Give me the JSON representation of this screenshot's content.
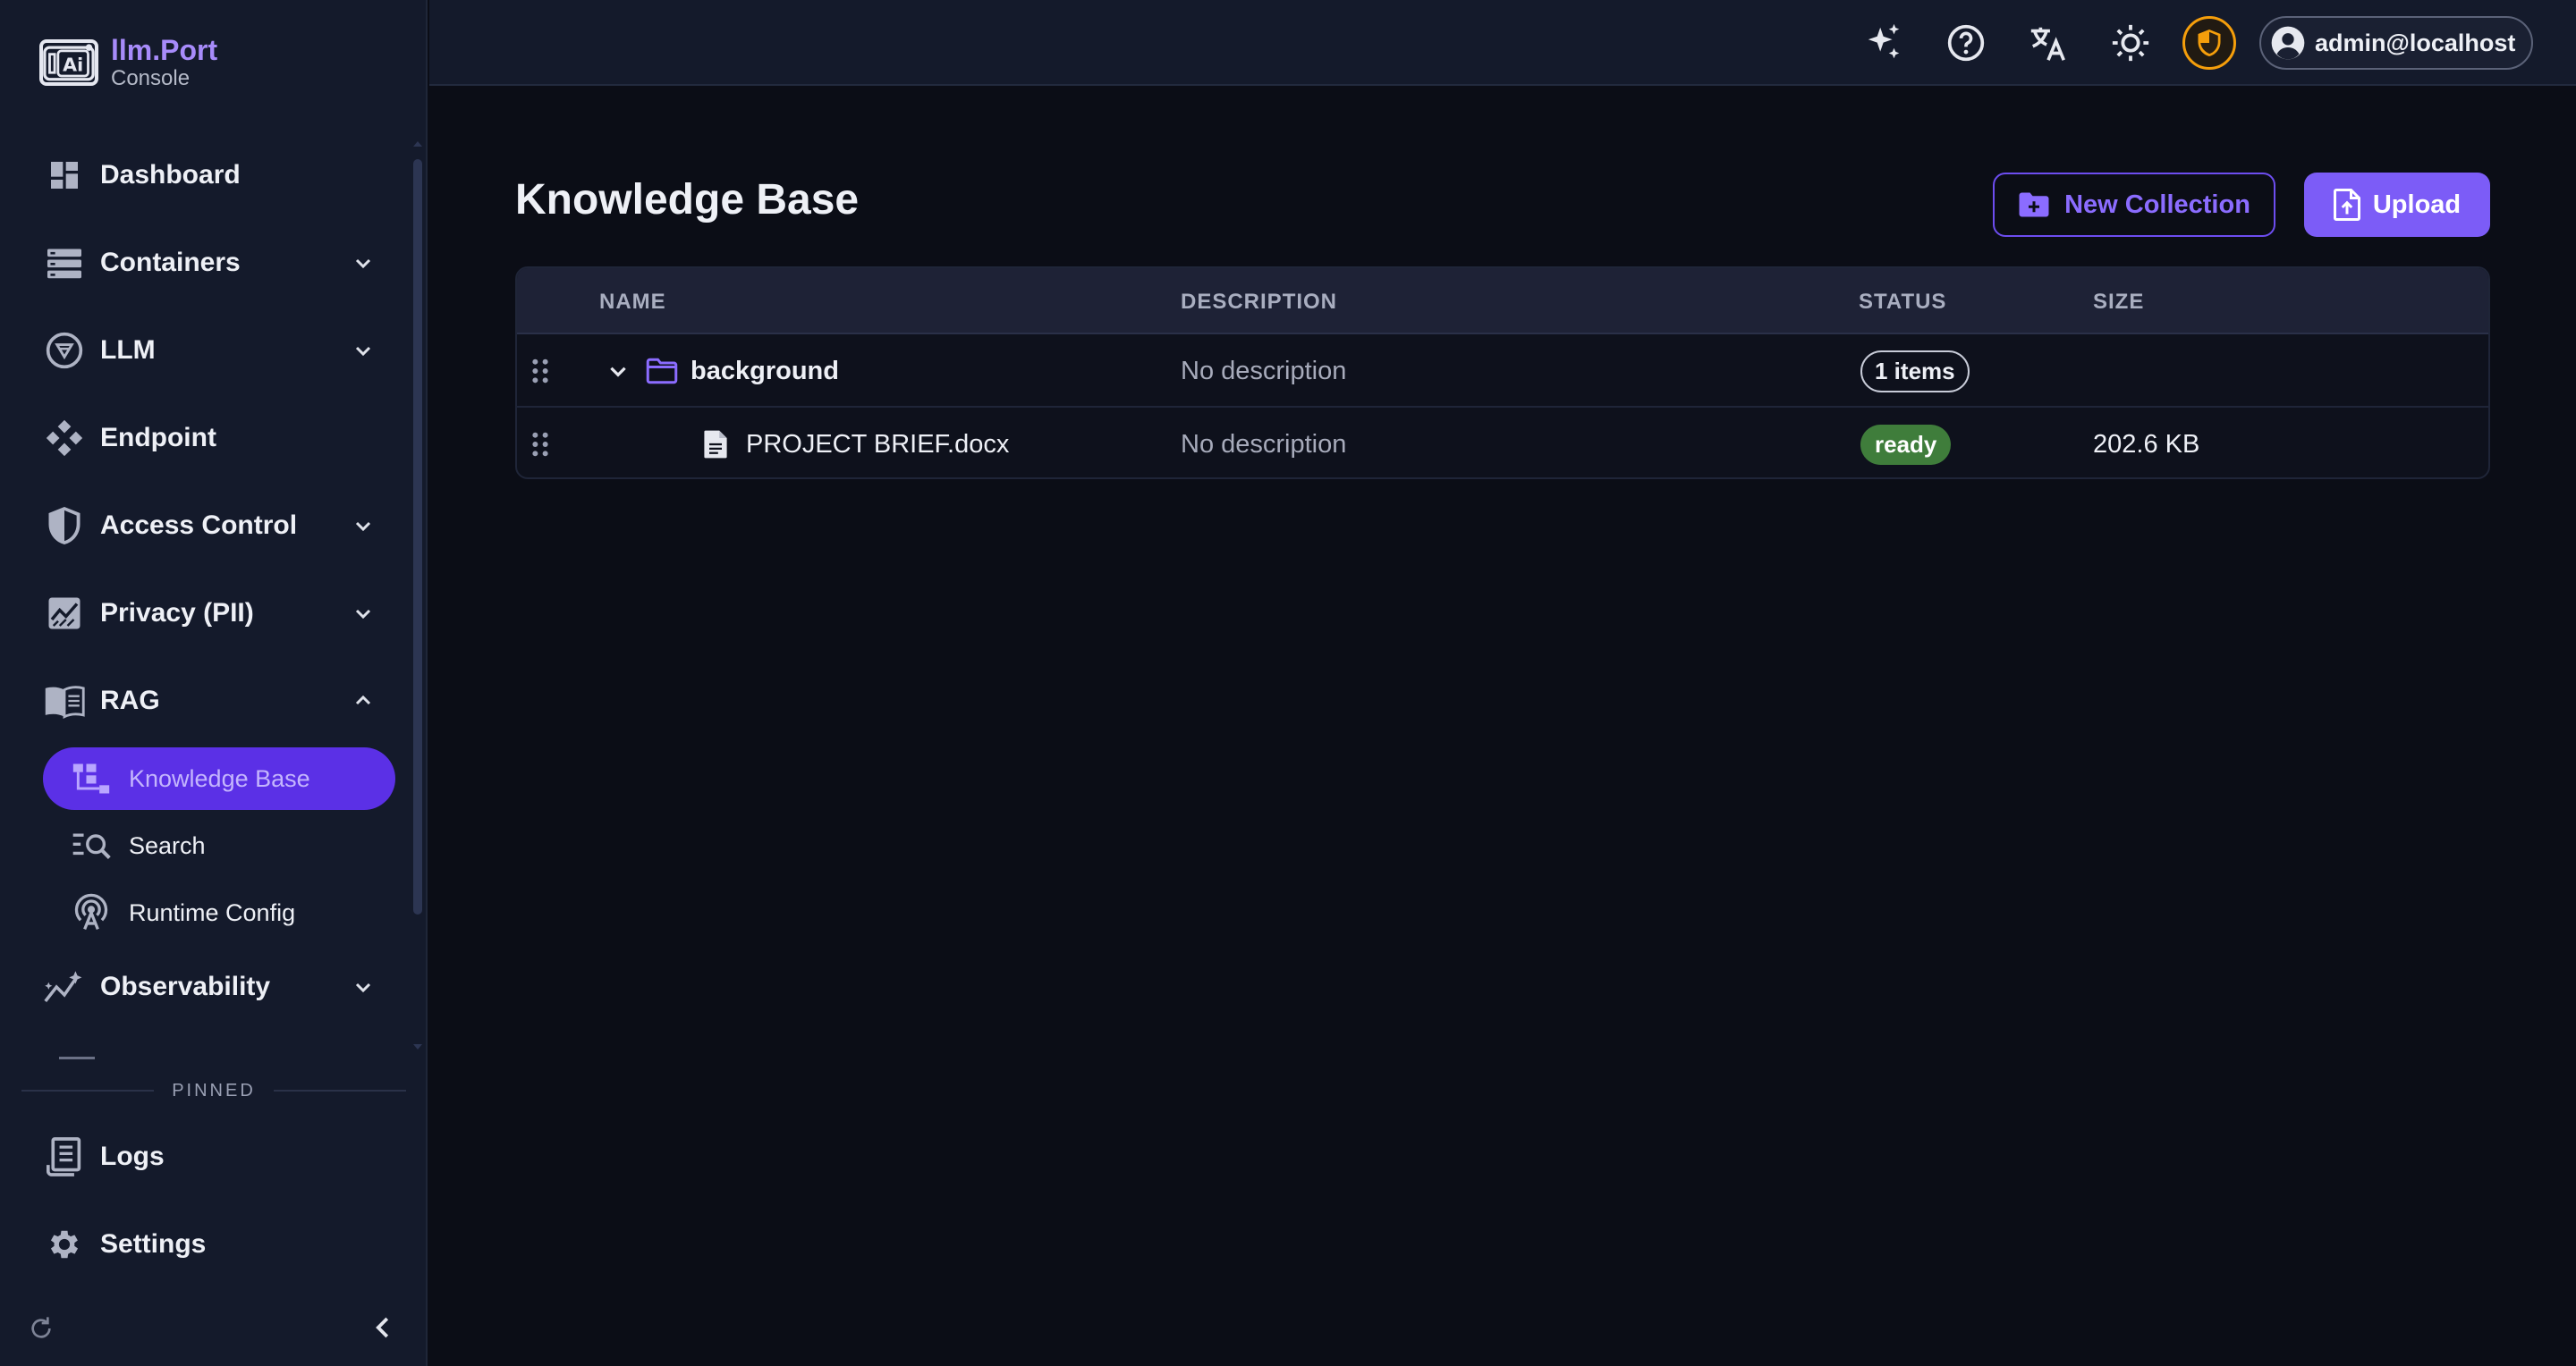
{
  "brand": {
    "name": "llm.Port",
    "subtitle": "Console",
    "logo_text": "Ai"
  },
  "sidebar": {
    "items": [
      {
        "label": "Dashboard",
        "icon": "dashboard-icon",
        "expandable": false
      },
      {
        "label": "Containers",
        "icon": "containers-icon",
        "expandable": true,
        "expanded": false
      },
      {
        "label": "LLM",
        "icon": "llm-icon",
        "expandable": true,
        "expanded": false
      },
      {
        "label": "Endpoint",
        "icon": "endpoint-icon",
        "expandable": false
      },
      {
        "label": "Access Control",
        "icon": "shield-icon",
        "expandable": true,
        "expanded": false
      },
      {
        "label": "Privacy (PII)",
        "icon": "privacy-chart-icon",
        "expandable": true,
        "expanded": false
      },
      {
        "label": "RAG",
        "icon": "book-icon",
        "expandable": true,
        "expanded": true
      },
      {
        "label": "Observability",
        "icon": "observability-icon",
        "expandable": true,
        "expanded": false
      }
    ],
    "rag_children": [
      {
        "label": "Knowledge Base",
        "icon": "knowledge-base-icon",
        "active": true
      },
      {
        "label": "Search",
        "icon": "search-list-icon",
        "active": false
      },
      {
        "label": "Runtime Config",
        "icon": "antenna-icon",
        "active": false
      }
    ],
    "pinned_label": "PINNED",
    "pinned": [
      {
        "label": "Logs",
        "icon": "logs-icon"
      },
      {
        "label": "Settings",
        "icon": "gear-icon"
      }
    ]
  },
  "topbar": {
    "icons": [
      "sparkle-icon",
      "help-icon",
      "translate-icon",
      "theme-sun-icon",
      "security-shield-icon"
    ],
    "user": "admin@localhost"
  },
  "main": {
    "title": "Knowledge Base",
    "new_collection_label": "New Collection",
    "upload_label": "Upload",
    "table": {
      "headers": {
        "name": "NAME",
        "description": "DESCRIPTION",
        "status": "STATUS",
        "size": "SIZE"
      },
      "rows": [
        {
          "type": "folder",
          "name": "background",
          "description": "No description",
          "status": "1 items",
          "size": ""
        },
        {
          "type": "file",
          "name": "PROJECT BRIEF.docx",
          "description": "No description",
          "status": "ready",
          "size": "202.6 KB"
        }
      ]
    }
  },
  "colors": {
    "accent": "#7c5cf7",
    "accent_text": "#a78bfa",
    "active_nav": "#5b30e6",
    "ready_badge": "#3f7d3b",
    "shield_ring": "#f59e0b"
  }
}
